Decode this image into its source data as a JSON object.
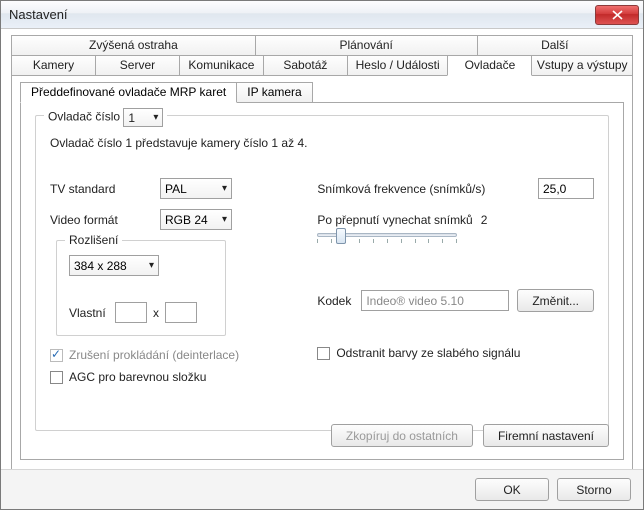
{
  "window": {
    "title": "Nastavení"
  },
  "tabsTop": {
    "t0": "Zvýšená ostraha",
    "t1": "Plánování",
    "t2": "Další"
  },
  "tabsBottom": {
    "t0": "Kamery",
    "t1": "Server",
    "t2": "Komunikace",
    "t3": "Sabotáž",
    "t4": "Heslo / Události",
    "t5": "Ovladače",
    "t6": "Vstupy a výstupy"
  },
  "subtabs": {
    "t0": "Předdefinované ovladače MRP karet",
    "t1": "IP kamera"
  },
  "driver": {
    "legend_prefix": "Ovladač číslo",
    "number": "1",
    "description": "Ovladač číslo 1 představuje kamery číslo 1 až 4.",
    "tv_label": "TV standard",
    "tv_value": "PAL",
    "video_label": "Video formát",
    "video_value": "RGB 24",
    "resolution": {
      "legend": "Rozlišení",
      "value": "384 x 288",
      "custom_label": "Vlastní",
      "x": "x"
    },
    "fps_label": "Snímková frekvence (snímků/s)",
    "fps_value": "25,0",
    "skip_label": "Po přepnutí vynechat snímků",
    "skip_value": "2",
    "codec_label": "Kodek",
    "codec_value": "Indeo® video 5.10",
    "codec_change": "Změnit...",
    "deinterlace": "Zrušení prokládání (deinterlace)",
    "agc": "AGC pro barevnou složku",
    "remove_colors": "Odstranit barvy ze slabého signálu",
    "copy_btn": "Zkopíruj do ostatních",
    "factory_btn": "Firemní nastavení"
  },
  "footer": {
    "ok": "OK",
    "cancel": "Storno"
  }
}
